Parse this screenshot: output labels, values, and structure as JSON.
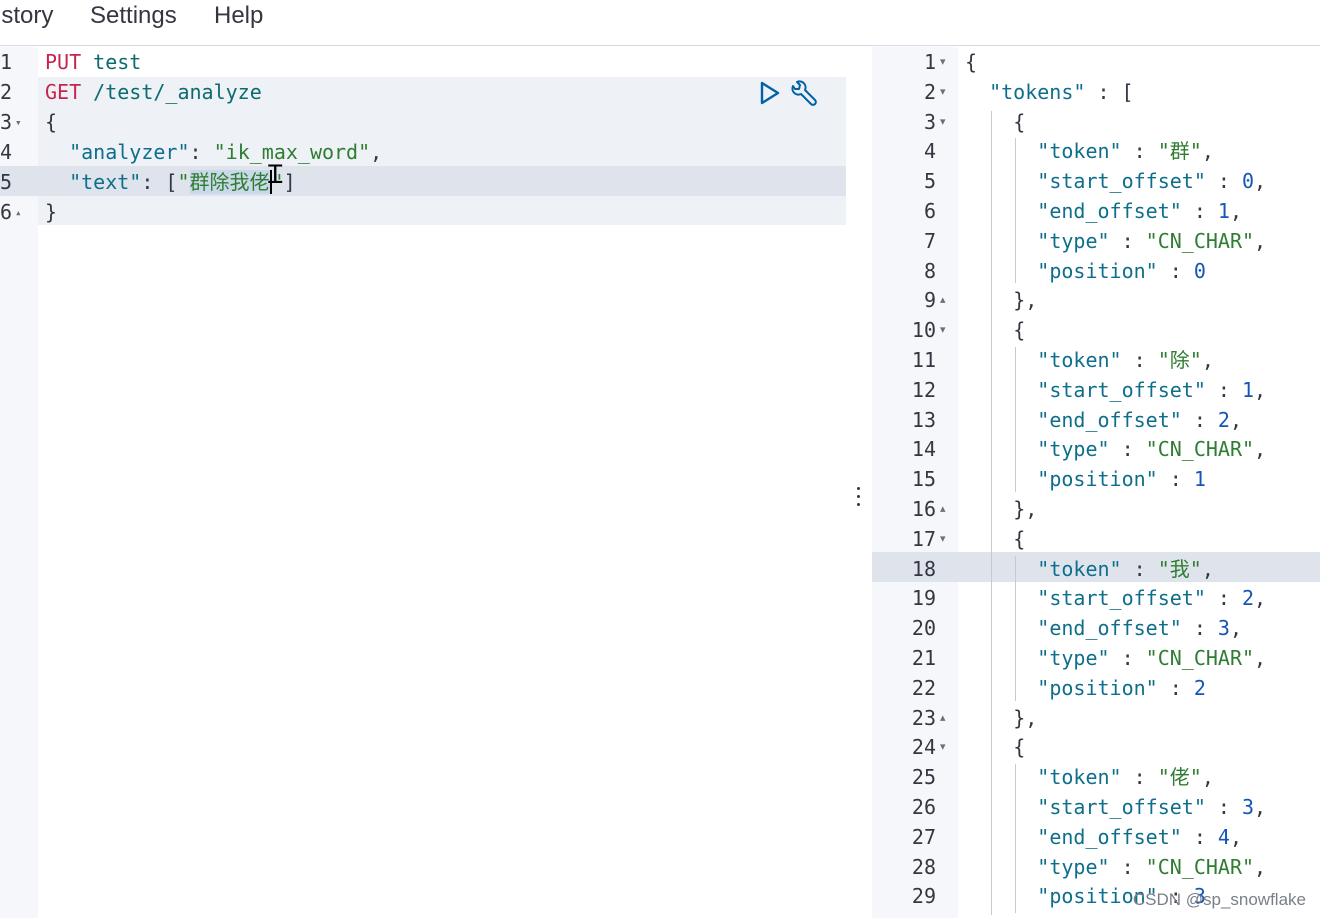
{
  "menu": {
    "history": "istory",
    "settings": "Settings",
    "help": "Help"
  },
  "request": {
    "lines": [
      {
        "n": "1",
        "fold": "",
        "tokens": [
          {
            "t": "PUT",
            "c": "method"
          },
          {
            "t": " ",
            "c": "punc"
          },
          {
            "t": "test",
            "c": "url"
          }
        ]
      },
      {
        "n": "2",
        "fold": "",
        "tokens": [
          {
            "t": "GET",
            "c": "method"
          },
          {
            "t": " ",
            "c": "punc"
          },
          {
            "t": "/test/_analyze",
            "c": "url"
          }
        ]
      },
      {
        "n": "3",
        "fold": "▾",
        "tokens": [
          {
            "t": "{",
            "c": "punc"
          }
        ]
      },
      {
        "n": "4",
        "fold": "",
        "tokens": [
          {
            "t": "  ",
            "c": "punc"
          },
          {
            "t": "\"analyzer\"",
            "c": "key"
          },
          {
            "t": ": ",
            "c": "punc"
          },
          {
            "t": "\"ik_max_word\"",
            "c": "str"
          },
          {
            "t": ",",
            "c": "punc"
          }
        ]
      },
      {
        "n": "5",
        "fold": "",
        "tokens": [
          {
            "t": "  ",
            "c": "punc"
          },
          {
            "t": "\"text\"",
            "c": "key"
          },
          {
            "t": ": [",
            "c": "punc"
          },
          {
            "t": "\"",
            "c": "str"
          },
          {
            "t": "群除我佬",
            "c": "sel"
          },
          {
            "t": "|caret",
            "c": "caret"
          },
          {
            "t": "\"",
            "c": "str"
          },
          {
            "t": "]",
            "c": "punc"
          }
        ]
      },
      {
        "n": "6",
        "fold": "▴",
        "tokens": [
          {
            "t": "}",
            "c": "punc"
          }
        ]
      }
    ]
  },
  "actions": {
    "run": "play-icon",
    "settings": "wrench-icon"
  },
  "response": {
    "lines": [
      {
        "n": "1",
        "fold": "▾",
        "indent": 0,
        "tokens": [
          {
            "t": "{",
            "c": "punc"
          }
        ]
      },
      {
        "n": "2",
        "fold": "▾",
        "indent": 1,
        "tokens": [
          {
            "t": "\"tokens\"",
            "c": "key"
          },
          {
            "t": " : [",
            "c": "punc"
          }
        ]
      },
      {
        "n": "3",
        "fold": "▾",
        "indent": 2,
        "tokens": [
          {
            "t": "{",
            "c": "punc"
          }
        ]
      },
      {
        "n": "4",
        "fold": "",
        "indent": 3,
        "tokens": [
          {
            "t": "\"token\"",
            "c": "key"
          },
          {
            "t": " : ",
            "c": "punc"
          },
          {
            "t": "\"群\"",
            "c": "str"
          },
          {
            "t": ",",
            "c": "punc"
          }
        ]
      },
      {
        "n": "5",
        "fold": "",
        "indent": 3,
        "tokens": [
          {
            "t": "\"start_offset\"",
            "c": "key"
          },
          {
            "t": " : ",
            "c": "punc"
          },
          {
            "t": "0",
            "c": "num"
          },
          {
            "t": ",",
            "c": "punc"
          }
        ]
      },
      {
        "n": "6",
        "fold": "",
        "indent": 3,
        "tokens": [
          {
            "t": "\"end_offset\"",
            "c": "key"
          },
          {
            "t": " : ",
            "c": "punc"
          },
          {
            "t": "1",
            "c": "num"
          },
          {
            "t": ",",
            "c": "punc"
          }
        ]
      },
      {
        "n": "7",
        "fold": "",
        "indent": 3,
        "tokens": [
          {
            "t": "\"type\"",
            "c": "key"
          },
          {
            "t": " : ",
            "c": "punc"
          },
          {
            "t": "\"CN_CHAR\"",
            "c": "str"
          },
          {
            "t": ",",
            "c": "punc"
          }
        ]
      },
      {
        "n": "8",
        "fold": "",
        "indent": 3,
        "tokens": [
          {
            "t": "\"position\"",
            "c": "key"
          },
          {
            "t": " : ",
            "c": "punc"
          },
          {
            "t": "0",
            "c": "num"
          }
        ]
      },
      {
        "n": "9",
        "fold": "▴",
        "indent": 2,
        "tokens": [
          {
            "t": "},",
            "c": "punc"
          }
        ]
      },
      {
        "n": "10",
        "fold": "▾",
        "indent": 2,
        "tokens": [
          {
            "t": "{",
            "c": "punc"
          }
        ]
      },
      {
        "n": "11",
        "fold": "",
        "indent": 3,
        "tokens": [
          {
            "t": "\"token\"",
            "c": "key"
          },
          {
            "t": " : ",
            "c": "punc"
          },
          {
            "t": "\"除\"",
            "c": "str"
          },
          {
            "t": ",",
            "c": "punc"
          }
        ]
      },
      {
        "n": "12",
        "fold": "",
        "indent": 3,
        "tokens": [
          {
            "t": "\"start_offset\"",
            "c": "key"
          },
          {
            "t": " : ",
            "c": "punc"
          },
          {
            "t": "1",
            "c": "num"
          },
          {
            "t": ",",
            "c": "punc"
          }
        ]
      },
      {
        "n": "13",
        "fold": "",
        "indent": 3,
        "tokens": [
          {
            "t": "\"end_offset\"",
            "c": "key"
          },
          {
            "t": " : ",
            "c": "punc"
          },
          {
            "t": "2",
            "c": "num"
          },
          {
            "t": ",",
            "c": "punc"
          }
        ]
      },
      {
        "n": "14",
        "fold": "",
        "indent": 3,
        "tokens": [
          {
            "t": "\"type\"",
            "c": "key"
          },
          {
            "t": " : ",
            "c": "punc"
          },
          {
            "t": "\"CN_CHAR\"",
            "c": "str"
          },
          {
            "t": ",",
            "c": "punc"
          }
        ]
      },
      {
        "n": "15",
        "fold": "",
        "indent": 3,
        "tokens": [
          {
            "t": "\"position\"",
            "c": "key"
          },
          {
            "t": " : ",
            "c": "punc"
          },
          {
            "t": "1",
            "c": "num"
          }
        ]
      },
      {
        "n": "16",
        "fold": "▴",
        "indent": 2,
        "tokens": [
          {
            "t": "},",
            "c": "punc"
          }
        ]
      },
      {
        "n": "17",
        "fold": "▾",
        "indent": 2,
        "tokens": [
          {
            "t": "{",
            "c": "punc"
          }
        ]
      },
      {
        "n": "18",
        "fold": "",
        "indent": 3,
        "tokens": [
          {
            "t": "\"token\"",
            "c": "key"
          },
          {
            "t": " : ",
            "c": "punc"
          },
          {
            "t": "\"我\"",
            "c": "str"
          },
          {
            "t": ",",
            "c": "punc"
          }
        ]
      },
      {
        "n": "19",
        "fold": "",
        "indent": 3,
        "tokens": [
          {
            "t": "\"start_offset\"",
            "c": "key"
          },
          {
            "t": " : ",
            "c": "punc"
          },
          {
            "t": "2",
            "c": "num"
          },
          {
            "t": ",",
            "c": "punc"
          }
        ]
      },
      {
        "n": "20",
        "fold": "",
        "indent": 3,
        "tokens": [
          {
            "t": "\"end_offset\"",
            "c": "key"
          },
          {
            "t": " : ",
            "c": "punc"
          },
          {
            "t": "3",
            "c": "num"
          },
          {
            "t": ",",
            "c": "punc"
          }
        ]
      },
      {
        "n": "21",
        "fold": "",
        "indent": 3,
        "tokens": [
          {
            "t": "\"type\"",
            "c": "key"
          },
          {
            "t": " : ",
            "c": "punc"
          },
          {
            "t": "\"CN_CHAR\"",
            "c": "str"
          },
          {
            "t": ",",
            "c": "punc"
          }
        ]
      },
      {
        "n": "22",
        "fold": "",
        "indent": 3,
        "tokens": [
          {
            "t": "\"position\"",
            "c": "key"
          },
          {
            "t": " : ",
            "c": "punc"
          },
          {
            "t": "2",
            "c": "num"
          }
        ]
      },
      {
        "n": "23",
        "fold": "▴",
        "indent": 2,
        "tokens": [
          {
            "t": "},",
            "c": "punc"
          }
        ]
      },
      {
        "n": "24",
        "fold": "▾",
        "indent": 2,
        "tokens": [
          {
            "t": "{",
            "c": "punc"
          }
        ]
      },
      {
        "n": "25",
        "fold": "",
        "indent": 3,
        "tokens": [
          {
            "t": "\"token\"",
            "c": "key"
          },
          {
            "t": " : ",
            "c": "punc"
          },
          {
            "t": "\"佬\"",
            "c": "str"
          },
          {
            "t": ",",
            "c": "punc"
          }
        ]
      },
      {
        "n": "26",
        "fold": "",
        "indent": 3,
        "tokens": [
          {
            "t": "\"start_offset\"",
            "c": "key"
          },
          {
            "t": " : ",
            "c": "punc"
          },
          {
            "t": "3",
            "c": "num"
          },
          {
            "t": ",",
            "c": "punc"
          }
        ]
      },
      {
        "n": "27",
        "fold": "",
        "indent": 3,
        "tokens": [
          {
            "t": "\"end_offset\"",
            "c": "key"
          },
          {
            "t": " : ",
            "c": "punc"
          },
          {
            "t": "4",
            "c": "num"
          },
          {
            "t": ",",
            "c": "punc"
          }
        ]
      },
      {
        "n": "28",
        "fold": "",
        "indent": 3,
        "tokens": [
          {
            "t": "\"type\"",
            "c": "key"
          },
          {
            "t": " : ",
            "c": "punc"
          },
          {
            "t": "\"CN_CHAR\"",
            "c": "str"
          },
          {
            "t": ",",
            "c": "punc"
          }
        ]
      },
      {
        "n": "29",
        "fold": "",
        "indent": 3,
        "tokens": [
          {
            "t": "\"position\"",
            "c": "key"
          },
          {
            "t": " : ",
            "c": "punc"
          },
          {
            "t": "3",
            "c": "num"
          }
        ]
      }
    ]
  },
  "watermark": "CSDN @sp_snowflake",
  "colors": {
    "method": "#c7254e",
    "url": "#0b6b6e",
    "key": "#0e6e8c",
    "string": "#2f7d32",
    "number": "#1456b8",
    "active_line": "#dfe4ec",
    "gutter": "#f5f7fa"
  }
}
